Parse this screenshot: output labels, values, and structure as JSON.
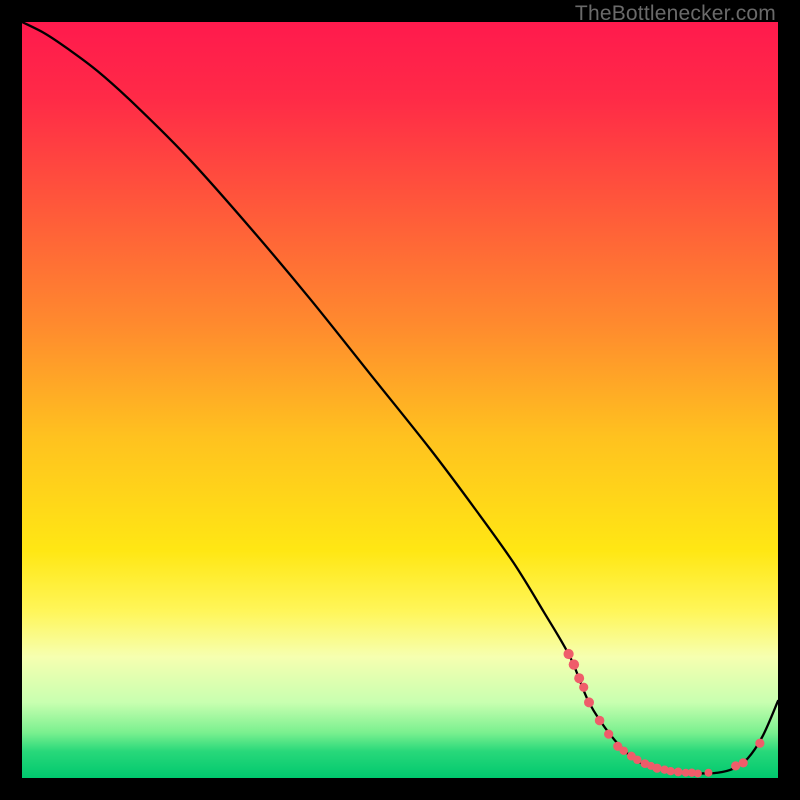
{
  "watermark": "TheBottlenecker.com",
  "chart_data": {
    "type": "line",
    "title": "",
    "xlabel": "",
    "ylabel": "",
    "xlim": [
      0,
      100
    ],
    "ylim": [
      0,
      100
    ],
    "background_gradient": {
      "stops": [
        {
          "offset": 0.0,
          "color": "#ff1a4d"
        },
        {
          "offset": 0.1,
          "color": "#ff2a47"
        },
        {
          "offset": 0.25,
          "color": "#ff5a3a"
        },
        {
          "offset": 0.4,
          "color": "#ff8a2e"
        },
        {
          "offset": 0.55,
          "color": "#ffc21f"
        },
        {
          "offset": 0.7,
          "color": "#ffe714"
        },
        {
          "offset": 0.78,
          "color": "#fff65a"
        },
        {
          "offset": 0.84,
          "color": "#f6ffb0"
        },
        {
          "offset": 0.9,
          "color": "#c8ffb0"
        },
        {
          "offset": 0.94,
          "color": "#7af08f"
        },
        {
          "offset": 0.965,
          "color": "#28d87a"
        },
        {
          "offset": 1.0,
          "color": "#00c86e"
        }
      ]
    },
    "series": [
      {
        "name": "bottleneck-curve",
        "x": [
          0,
          3,
          6,
          10,
          15,
          22,
          30,
          38,
          46,
          54,
          60,
          65,
          69,
          72.5,
          75,
          78,
          81,
          84,
          87,
          89.5,
          92,
          94,
          96,
          98,
          100
        ],
        "y": [
          100,
          98.5,
          96.5,
          93.5,
          89,
          82,
          73,
          63.5,
          53.5,
          43.5,
          35.5,
          28.5,
          22,
          16,
          10,
          5.5,
          2.5,
          1.2,
          0.7,
          0.6,
          0.7,
          1.2,
          2.6,
          5.6,
          10.2
        ]
      }
    ],
    "markers": {
      "name": "cluster-points",
      "color": "#ef5d6a",
      "points": [
        {
          "x": 72.3,
          "y": 16.4,
          "r": 5.1
        },
        {
          "x": 73.0,
          "y": 15.0,
          "r": 5.2
        },
        {
          "x": 73.7,
          "y": 13.2,
          "r": 5.0
        },
        {
          "x": 74.3,
          "y": 12.0,
          "r": 4.6
        },
        {
          "x": 75.0,
          "y": 10.0,
          "r": 5.0
        },
        {
          "x": 76.4,
          "y": 7.6,
          "r": 4.8
        },
        {
          "x": 77.6,
          "y": 5.8,
          "r": 4.6
        },
        {
          "x": 78.8,
          "y": 4.2,
          "r": 4.6
        },
        {
          "x": 79.6,
          "y": 3.6,
          "r": 4.2
        },
        {
          "x": 80.6,
          "y": 2.9,
          "r": 4.4
        },
        {
          "x": 81.4,
          "y": 2.4,
          "r": 4.2
        },
        {
          "x": 82.4,
          "y": 1.9,
          "r": 4.4
        },
        {
          "x": 83.2,
          "y": 1.6,
          "r": 4.0
        },
        {
          "x": 84.0,
          "y": 1.3,
          "r": 4.6
        },
        {
          "x": 85.0,
          "y": 1.1,
          "r": 4.2
        },
        {
          "x": 85.8,
          "y": 0.9,
          "r": 4.2
        },
        {
          "x": 86.8,
          "y": 0.8,
          "r": 4.4
        },
        {
          "x": 87.8,
          "y": 0.7,
          "r": 4.0
        },
        {
          "x": 88.6,
          "y": 0.7,
          "r": 4.2
        },
        {
          "x": 89.4,
          "y": 0.6,
          "r": 4.0
        },
        {
          "x": 90.8,
          "y": 0.7,
          "r": 4.0
        },
        {
          "x": 94.4,
          "y": 1.6,
          "r": 4.6
        },
        {
          "x": 95.4,
          "y": 2.0,
          "r": 4.6
        },
        {
          "x": 97.6,
          "y": 4.6,
          "r": 4.6
        }
      ]
    }
  }
}
